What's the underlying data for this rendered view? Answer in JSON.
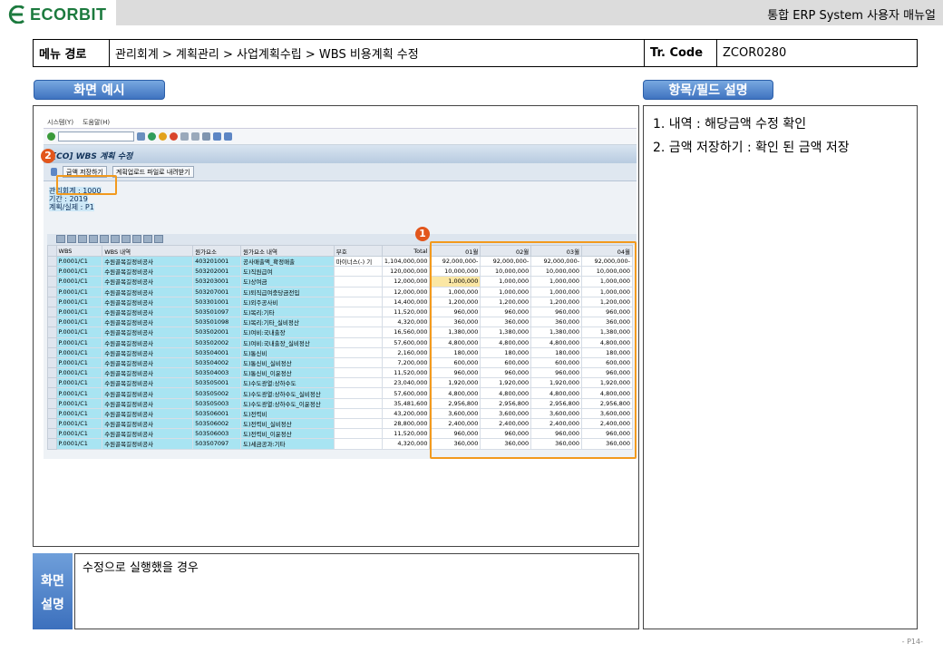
{
  "header": {
    "logo": "ECORBIT",
    "doc_title": "통합 ERP System 사용자 매뉴얼"
  },
  "path": {
    "menu_label": "메뉴 경로",
    "menu_value": "관리회계 > 계획관리 > 사업계획수립 > WBS 비용계획 수정",
    "tcode_label": "Tr. Code",
    "tcode_value": "ZCOR0280"
  },
  "sections": {
    "screen_example": "화면 예시",
    "field_desc": "항목/필드 설명",
    "screen_desc_label_1": "화면",
    "screen_desc_label_2": "설명",
    "screen_desc_text": "수정으로 실행했을 경우"
  },
  "descriptions": [
    "1.  내역 : 해당금액 수정 확인",
    "2.  금액 저장하기 : 확인 된 금액 저장"
  ],
  "sap": {
    "menu": [
      "시스템(Y)",
      "도움말(H)"
    ],
    "title": "[CO] WBS 계획 수정",
    "btn_save": "금액 저장하기",
    "btn_download": "계획업로드 파일로 내려받기",
    "info": [
      "관리회계 : 1000",
      "기간 : 2019",
      "계획/실제 : P1"
    ],
    "columns": [
      "WBS",
      "WBS 내역",
      "원가요소",
      "원가요소 내역",
      "부호",
      "Total",
      "01월",
      "02월",
      "03월",
      "04월"
    ],
    "rows": [
      [
        "P.0001/C1",
        "수원골목길정비공사",
        "403201001",
        "공사매출액_확정매출",
        "마이너스(-) 기",
        "1,104,000,000",
        "92,000,000-",
        "92,000,000-",
        "92,000,000-",
        "92,000,000-"
      ],
      [
        "P.0001/C1",
        "수원골목길정비공사",
        "503202001",
        "도)직원급여",
        "",
        "120,000,000",
        "10,000,000",
        "10,000,000",
        "10,000,000",
        "10,000,000"
      ],
      [
        "P.0001/C1",
        "수원골목길정비공사",
        "503203001",
        "도)상여금",
        "",
        "12,000,000",
        "1,000,000",
        "1,000,000",
        "1,000,000",
        "1,000,000"
      ],
      [
        "P.0001/C1",
        "수원골목길정비공사",
        "503207001",
        "도)퇴직급여충당금전입",
        "",
        "12,000,000",
        "1,000,000",
        "1,000,000",
        "1,000,000",
        "1,000,000"
      ],
      [
        "P.0001/C1",
        "수원골목길정비공사",
        "503301001",
        "도)외주공사비",
        "",
        "14,400,000",
        "1,200,000",
        "1,200,000",
        "1,200,000",
        "1,200,000"
      ],
      [
        "P.0001/C1",
        "수원골목길정비공사",
        "503501097",
        "도)복리:기타",
        "",
        "11,520,000",
        "960,000",
        "960,000",
        "960,000",
        "960,000"
      ],
      [
        "P.0001/C1",
        "수원골목길정비공사",
        "503501098",
        "도)복리:기타_실비정산",
        "",
        "4,320,000",
        "360,000",
        "360,000",
        "360,000",
        "360,000"
      ],
      [
        "P.0001/C1",
        "수원골목길정비공사",
        "503502001",
        "도)여비:국내출장",
        "",
        "16,560,000",
        "1,380,000",
        "1,380,000",
        "1,380,000",
        "1,380,000"
      ],
      [
        "P.0001/C1",
        "수원골목길정비공사",
        "503502002",
        "도)여비:국내출장_실비정산",
        "",
        "57,600,000",
        "4,800,000",
        "4,800,000",
        "4,800,000",
        "4,800,000"
      ],
      [
        "P.0001/C1",
        "수원골목길정비공사",
        "503504001",
        "도)통신비",
        "",
        "2,160,000",
        "180,000",
        "180,000",
        "180,000",
        "180,000"
      ],
      [
        "P.0001/C1",
        "수원골목길정비공사",
        "503504002",
        "도)통신비_실비정산",
        "",
        "7,200,000",
        "600,000",
        "600,000",
        "600,000",
        "600,000"
      ],
      [
        "P.0001/C1",
        "수원골목길정비공사",
        "503504003",
        "도)통신비_이윤정산",
        "",
        "11,520,000",
        "960,000",
        "960,000",
        "960,000",
        "960,000"
      ],
      [
        "P.0001/C1",
        "수원골목길정비공사",
        "503505001",
        "도)수도광열:상하수도",
        "",
        "23,040,000",
        "1,920,000",
        "1,920,000",
        "1,920,000",
        "1,920,000"
      ],
      [
        "P.0001/C1",
        "수원골목길정비공사",
        "503505002",
        "도)수도광열:상하수도_실비정산",
        "",
        "57,600,000",
        "4,800,000",
        "4,800,000",
        "4,800,000",
        "4,800,000"
      ],
      [
        "P.0001/C1",
        "수원골목길정비공사",
        "503505003",
        "도)수도광열:상하수도_이윤정산",
        "",
        "35,481,600",
        "2,956,800",
        "2,956,800",
        "2,956,800",
        "2,956,800"
      ],
      [
        "P.0001/C1",
        "수원골목길정비공사",
        "503506001",
        "도)전력비",
        "",
        "43,200,000",
        "3,600,000",
        "3,600,000",
        "3,600,000",
        "3,600,000"
      ],
      [
        "P.0001/C1",
        "수원골목길정비공사",
        "503506002",
        "도)전력비_실비정산",
        "",
        "28,800,000",
        "2,400,000",
        "2,400,000",
        "2,400,000",
        "2,400,000"
      ],
      [
        "P.0001/C1",
        "수원골목길정비공사",
        "503506003",
        "도)전력비_이윤정산",
        "",
        "11,520,000",
        "960,000",
        "960,000",
        "960,000",
        "960,000"
      ],
      [
        "P.0001/C1",
        "수원골목길정비공사",
        "503507097",
        "도)세금공과:기타",
        "",
        "4,320,000",
        "360,000",
        "360,000",
        "360,000",
        "360,000"
      ]
    ]
  },
  "markers": {
    "badge_1": "1",
    "badge_2": "2"
  },
  "page_number": "- P14-",
  "colors": {
    "accent_green": "#1c7a3e",
    "pill_blue": "#3f73c0",
    "highlight_orange": "#f29a1e",
    "key_cell": "#a8e4f2"
  }
}
